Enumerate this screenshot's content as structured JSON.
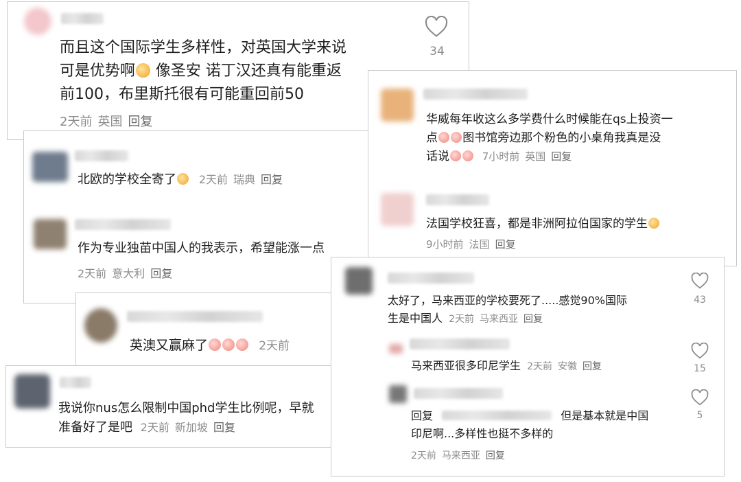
{
  "c1": {
    "line1": "而且这个国际学生多样性，对英国大学来说",
    "line2a": "可是优势啊",
    "line2b": "像圣安 诺丁汉还真有能重返",
    "line3": "前100，布里斯托很有可能重回前50",
    "time": "2天前",
    "loc": "英国",
    "reply": "回复",
    "likes": "34"
  },
  "c2": {
    "texta": "北欧的学校全寄了",
    "time": "2天前",
    "loc": "瑞典",
    "reply": "回复"
  },
  "c3": {
    "text": "作为专业独苗中国人的我表示，希望能涨一点",
    "time": "2天前",
    "loc": "意大利",
    "reply": "回复"
  },
  "c4": {
    "text": "英澳又赢麻了",
    "time": "2天前"
  },
  "c5": {
    "line1": "我说你nus怎么限制中国phd学生比例呢，早就",
    "line2": "准备好了是吧",
    "time": "2天前",
    "loc": "新加坡",
    "reply": "回复"
  },
  "c6": {
    "line1": "华威每年收这么多学费什么时候能在qs上投资一",
    "line2a": "点",
    "line2b": "图书馆旁边那个粉色的小桌角我真是没",
    "line3": "话说",
    "time": "7小时前",
    "loc": "英国",
    "reply": "回复"
  },
  "c7": {
    "text": "法国学校狂喜，都是非洲阿拉伯国家的学生",
    "time": "9小时前",
    "loc": "法国",
    "reply": "回复"
  },
  "c8": {
    "line1": "太好了，马来西亚的学校要死了.....感觉90%国际",
    "line2": "生是中国人",
    "time": "2天前",
    "loc": "马来西亚",
    "reply": "回复",
    "likes": "43"
  },
  "c9": {
    "text": "马来西亚很多印尼学生",
    "time": "2天前",
    "loc": "安徽",
    "reply": "回复",
    "likes": "15"
  },
  "c10": {
    "prefix": "回复",
    "line1": "但是基本就是中国",
    "line2": "印尼啊...多样性也挺不多样的",
    "time": "2天前",
    "loc": "马来西亚",
    "reply": "回复",
    "likes": "5"
  },
  "colors": {
    "meta": "#8c8c8c",
    "border": "#c9c9c9",
    "text": "#1e1e1e"
  },
  "icons": [
    "heart-icon",
    "emoji-icon",
    "avatar"
  ]
}
